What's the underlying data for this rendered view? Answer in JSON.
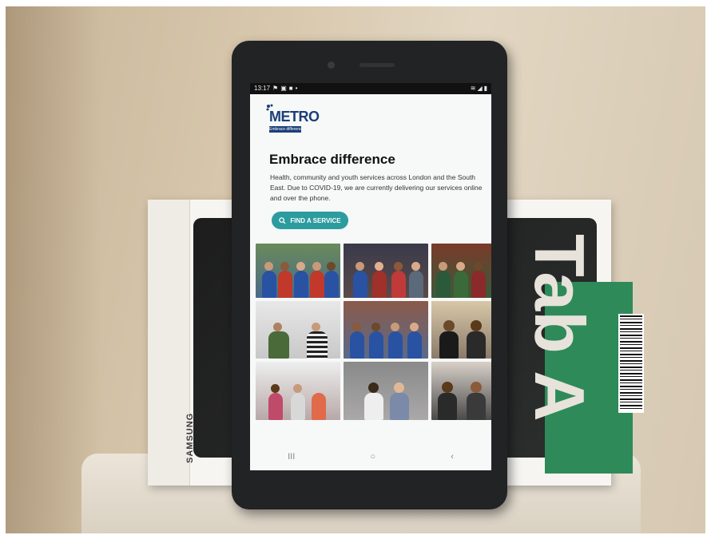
{
  "status_bar": {
    "time": "13:17",
    "left_icons": [
      "notification-icon",
      "image-icon",
      "message-icon",
      "dot-icon"
    ],
    "right_icons": [
      "wifi-icon",
      "signal-icon",
      "battery-icon"
    ]
  },
  "logo": {
    "name": "METRO",
    "tagline": "Embrace difference"
  },
  "hero": {
    "title": "Embrace difference",
    "intro": "Health, community and youth services across London and the South East. Due to COVID-19, we are currently delivering our services online and over the phone."
  },
  "cta": {
    "label": "FIND A SERVICE",
    "icon": "search-icon"
  },
  "photo_grid": {
    "tiles": 9
  },
  "navbar": {
    "recent": "III",
    "home": "○",
    "back": "‹"
  },
  "box": {
    "brand": "SAMSUNG",
    "lettering": "Tab A"
  },
  "colors": {
    "brand_blue": "#1a3e7a",
    "cta_teal": "#2c9c9f",
    "tablet_body": "#222325"
  }
}
